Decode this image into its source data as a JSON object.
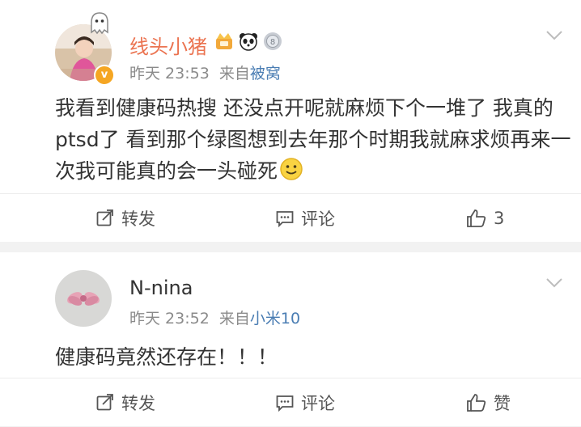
{
  "posts": [
    {
      "username": "线头小猪",
      "time": "昨天 23:53",
      "source_prefix": "来自",
      "source": "被窝",
      "content": "我看到健康码热搜 还没点开呢就麻烦下个一堆了 我真的ptsd了 看到那个绿图想到去年那个时期我就麻求烦再来一次我可能真的会一头碰死",
      "emoji": "smiley-emoji",
      "actions": {
        "repost": "转发",
        "comment": "评论",
        "like": "3"
      },
      "icons": [
        "ghost-icon",
        "crown-medal-icon",
        "panda-icon",
        "silver-medal-icon",
        "verified-badge-icon"
      ]
    },
    {
      "username": "N-nina",
      "time": "昨天 23:52",
      "source_prefix": "来自",
      "source": "小米10",
      "content": "健康码竟然还存在！！！",
      "actions": {
        "repost": "转发",
        "comment": "评论",
        "like": "赞"
      }
    }
  ],
  "colors": {
    "accent_name": "#eb7350",
    "source_link": "#4a7db3",
    "meta": "#8b8b8b",
    "background": "#f2f2f2"
  }
}
